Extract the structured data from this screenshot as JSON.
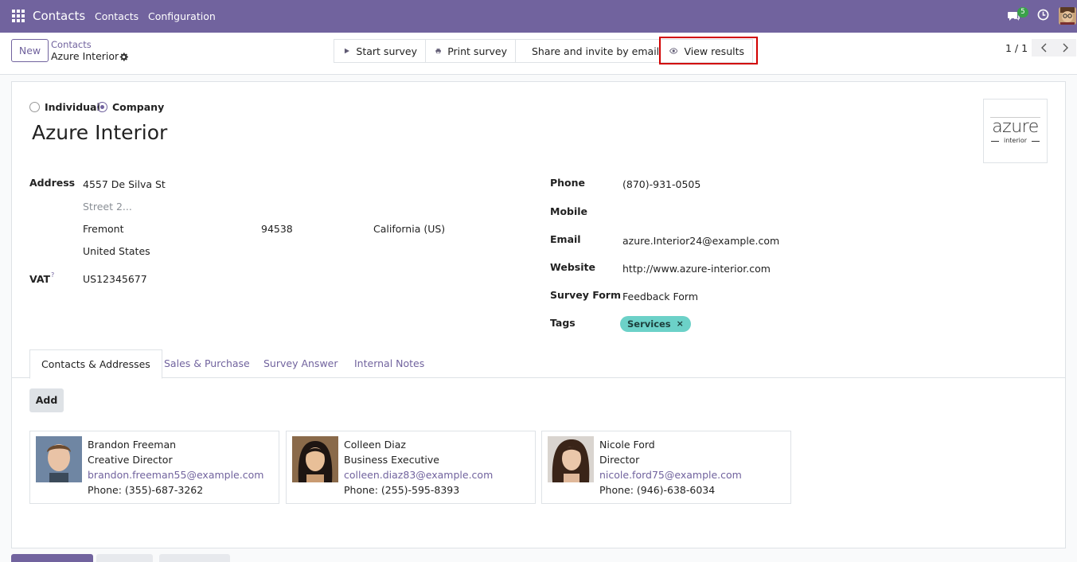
{
  "navbar": {
    "brand": "Contacts",
    "menu": [
      "Contacts",
      "Configuration"
    ],
    "chat_count": "5"
  },
  "control": {
    "new_label": "New",
    "breadcrumb_parent": "Contacts",
    "breadcrumb_current": "Azure Interior",
    "actions": [
      "Start survey",
      "Print survey",
      "Share and invite by email",
      "View results"
    ],
    "pager": "1 / 1"
  },
  "form": {
    "type_options": [
      "Individual",
      "Company"
    ],
    "type_selected": "Company",
    "name": "Azure Interior",
    "logo_text": "azure",
    "logo_sub": "interior",
    "labels": {
      "address": "Address",
      "vat": "VAT",
      "vat_help": "?",
      "phone": "Phone",
      "mobile": "Mobile",
      "email": "Email",
      "website": "Website",
      "survey_form": "Survey Form",
      "tags": "Tags"
    },
    "address": {
      "street": "4557 De Silva St",
      "street2_placeholder": "Street 2...",
      "city": "Fremont",
      "zip": "94538",
      "state": "California (US)",
      "country": "United States"
    },
    "vat": "US12345677",
    "phone": "(870)-931-0505",
    "mobile": "",
    "email": "azure.Interior24@example.com",
    "website": "http://www.azure-interior.com",
    "survey_form": "Feedback Form",
    "tag": "Services",
    "tag_remove": "×"
  },
  "tabs": [
    "Contacts & Addresses",
    "Sales & Purchase",
    "Survey Answer",
    "Internal Notes"
  ],
  "add_label": "Add",
  "contacts": [
    {
      "name": "Brandon Freeman",
      "role": "Creative Director",
      "email": "brandon.freeman55@example.com",
      "phone": "Phone: (355)-687-3262"
    },
    {
      "name": "Colleen Diaz",
      "role": "Business Executive",
      "email": "colleen.diaz83@example.com",
      "phone": "Phone: (255)-595-8393"
    },
    {
      "name": "Nicole Ford",
      "role": "Director",
      "email": "nicole.ford75@example.com",
      "phone": "Phone: (946)-638-6034"
    }
  ],
  "colors": {
    "brand": "#71639e",
    "highlight": "#d10000",
    "tag": "#6cd1c8"
  }
}
